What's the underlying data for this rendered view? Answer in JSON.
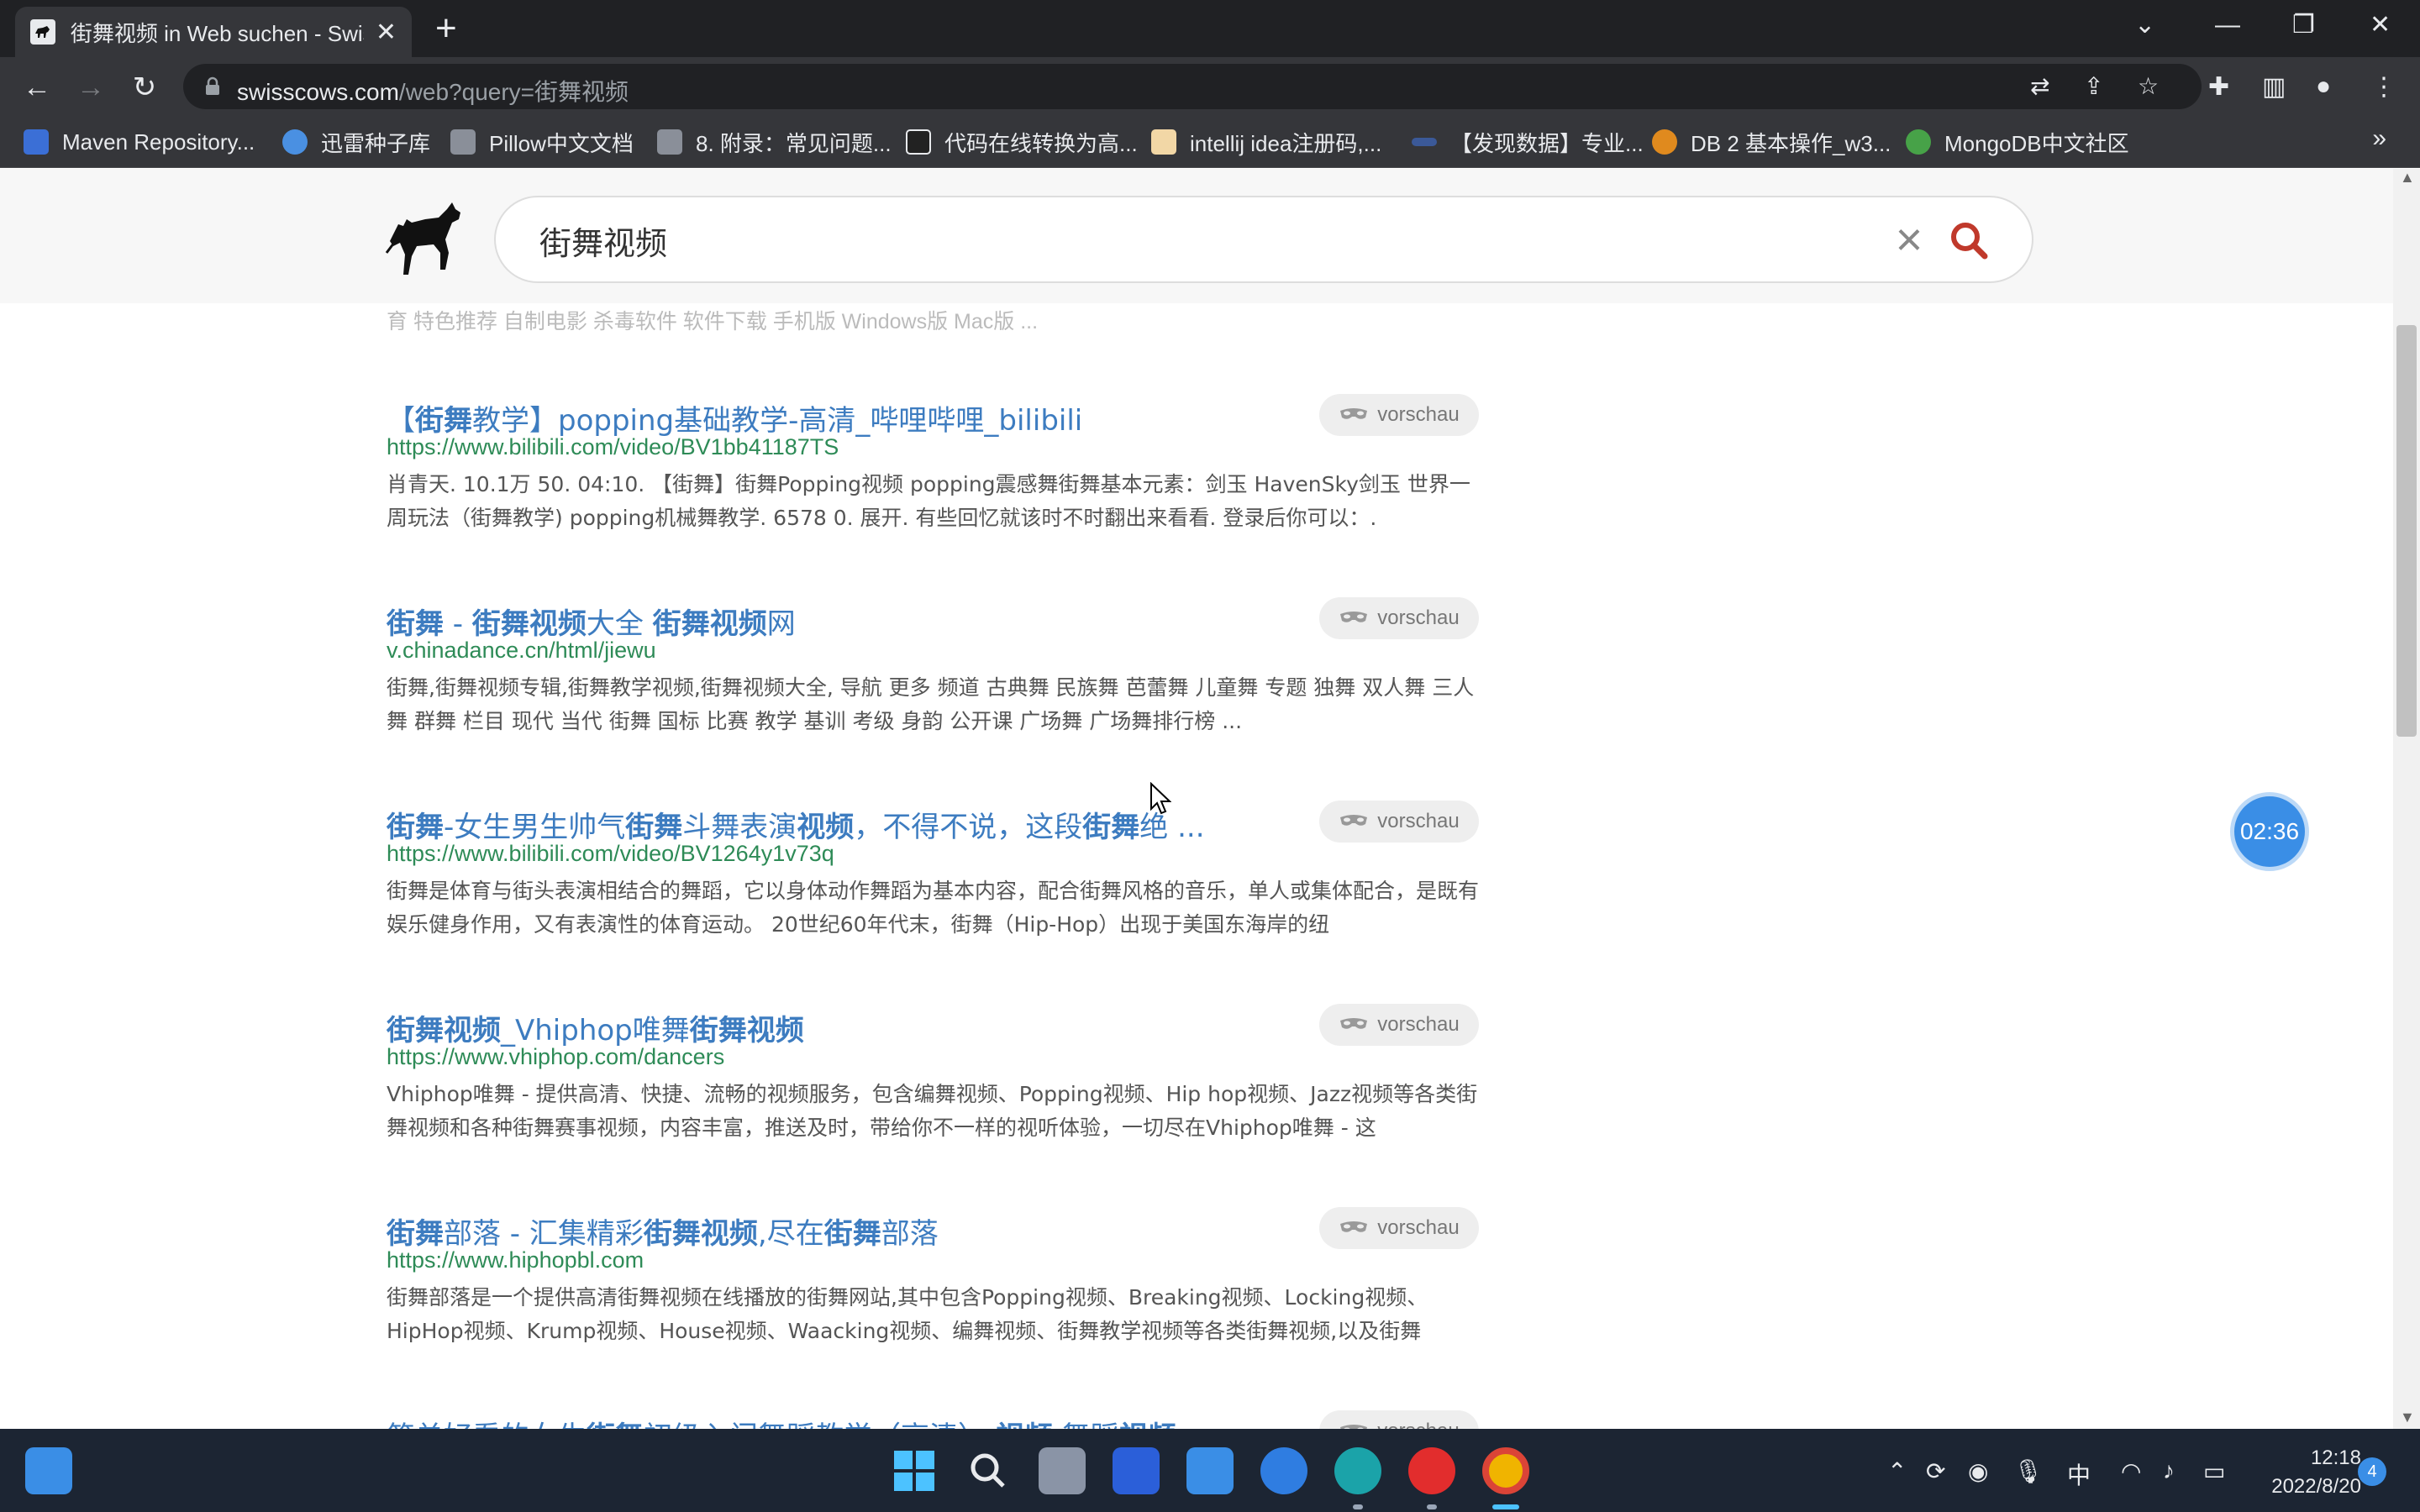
{
  "browser": {
    "tab_title": "街舞视频 in Web suchen - Swisscows",
    "url_host": "swisscows.com",
    "url_path": "/web?query=街舞视频",
    "new_tab_label": "+",
    "bookmarks": [
      {
        "label": "Maven Repository...",
        "color": "#3b6fd6"
      },
      {
        "label": "迅雷种子库",
        "color": "#4a90e2"
      },
      {
        "label": "Pillow中文文档",
        "color": "#8a8f99"
      },
      {
        "label": "8. 附录：常见问题...",
        "color": "#8a8f99"
      },
      {
        "label": "代码在线转换为高...",
        "color": "#222222"
      },
      {
        "label": "intellij idea注册码,...",
        "color": "#f2d7a6"
      },
      {
        "label": "【发现数据】专业...",
        "color": "#3b5998"
      },
      {
        "label": "DB 2 基本操作_w3...",
        "color": "#e08a1e"
      },
      {
        "label": "MongoDB中文社区",
        "color": "#47a248"
      }
    ]
  },
  "search": {
    "query": "街舞视频"
  },
  "prev_snippet": "育 特色推荐 自制电影 杀毒软件 软件下载 手机版 Windows版 Mac版 ...",
  "preview_label": "vorschau",
  "results": [
    {
      "title_parts": [
        {
          "t": "【",
          "b": false
        },
        {
          "t": "街舞",
          "b": true
        },
        {
          "t": "教学】popping基础教学-高清_哔哩哔哩_bilibili",
          "b": false
        }
      ],
      "url": "https://www.bilibili.com/video/BV1bb41187TS",
      "snippet": "肖青天. 10.1万 50. 04:10. 【街舞】街舞Popping视频 popping震感舞街舞基本元素：剑玉 HavenSky剑玉 世界一周玩法（街舞教学) popping机械舞教学. 6578 0. 展开. 有些回忆就该时不时翻出来看看. 登录后你可以：."
    },
    {
      "title_parts": [
        {
          "t": "街舞",
          "b": true
        },
        {
          "t": " - ",
          "b": false
        },
        {
          "t": "街舞视频",
          "b": true
        },
        {
          "t": "大全 ",
          "b": false
        },
        {
          "t": "街舞视频",
          "b": true
        },
        {
          "t": "网",
          "b": false
        }
      ],
      "url": "v.chinadance.cn/html/jiewu",
      "snippet": "街舞,街舞视频专辑,街舞教学视频,街舞视频大全, 导航 更多 频道 古典舞 民族舞 芭蕾舞 儿童舞 专题 独舞 双人舞 三人舞 群舞 栏目 现代 当代 街舞 国标 比赛 教学 基训 考级 身韵 公开课 广场舞 广场舞排行榜 ..."
    },
    {
      "title_parts": [
        {
          "t": "街舞",
          "b": true
        },
        {
          "t": "-女生男生帅气",
          "b": false
        },
        {
          "t": "街舞",
          "b": true
        },
        {
          "t": "斗舞表演",
          "b": false
        },
        {
          "t": "视频",
          "b": true
        },
        {
          "t": "，不得不说，这段",
          "b": false
        },
        {
          "t": "街舞",
          "b": true
        },
        {
          "t": "绝 ...",
          "b": false
        }
      ],
      "url": "https://www.bilibili.com/video/BV1264y1v73q",
      "snippet": "街舞是体育与街头表演相结合的舞蹈，它以身体动作舞蹈为基本内容，配合街舞风格的音乐，单人或集体配合，是既有娱乐健身作用，又有表演性的体育运动。 20世纪60年代末，街舞（Hip-Hop）出现于美国东海岸的纽"
    },
    {
      "title_parts": [
        {
          "t": "街舞视频",
          "b": true
        },
        {
          "t": "_Vhiphop唯舞",
          "b": false
        },
        {
          "t": "街舞视频",
          "b": true
        }
      ],
      "url": "https://www.vhiphop.com/dancers",
      "snippet": "Vhiphop唯舞 - 提供高清、快捷、流畅的视频服务，包含编舞视频、Popping视频、Hip hop视频、Jazz视频等各类街舞视频和各种街舞赛事视频，内容丰富，推送及时，带给你不一样的视听体验，一切尽在Vhiphop唯舞 - 这"
    },
    {
      "title_parts": [
        {
          "t": "街舞",
          "b": true
        },
        {
          "t": "部落 - 汇集精彩",
          "b": false
        },
        {
          "t": "街舞视频",
          "b": true
        },
        {
          "t": ",尽在",
          "b": false
        },
        {
          "t": "街舞",
          "b": true
        },
        {
          "t": "部落",
          "b": false
        }
      ],
      "url": "https://www.hiphopbl.com",
      "snippet": "街舞部落是一个提供高清街舞视频在线播放的街舞网站,其中包含Popping视频、Breaking视频、Locking视频、HipHop视频、Krump视频、House视频、Waacking视频、编舞视频、街舞教学视频等各类街舞视频,以及街舞"
    },
    {
      "title_parts": [
        {
          "t": "简单好看的女生",
          "b": false
        },
        {
          "t": "街舞",
          "b": true
        },
        {
          "t": "初级入门舞蹈教学（高清） ",
          "b": false
        },
        {
          "t": "视频",
          "b": true
        },
        {
          "t": " 舞蹈",
          "b": false
        },
        {
          "t": "视频",
          "b": true
        }
      ],
      "url": "",
      "snippet": ""
    }
  ],
  "timer": "02:36",
  "taskbar": {
    "time": "12:18",
    "date": "2022/8/20",
    "ime": "中",
    "notifications": "4"
  }
}
